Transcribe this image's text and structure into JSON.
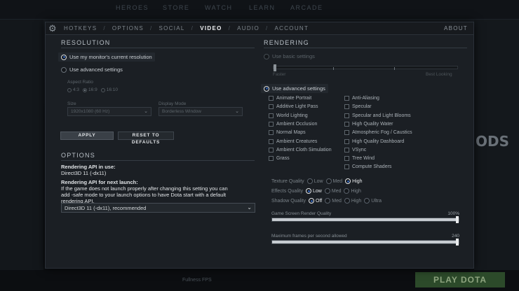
{
  "background": {
    "nav": [
      "HEROES",
      "STORE",
      "WATCH",
      "LEARN",
      "ARCADE"
    ],
    "play_button": "PLAY DOTA",
    "right_text": "ODS",
    "status_text": "Fullness FPS"
  },
  "tabs": {
    "items": [
      "HOTKEYS",
      "OPTIONS",
      "SOCIAL",
      "VIDEO",
      "AUDIO",
      "ACCOUNT"
    ],
    "active": "VIDEO",
    "about": "ABOUT"
  },
  "resolution": {
    "title": "RESOLUTION",
    "use_monitor": "Use my monitor's current resolution",
    "use_advanced": "Use advanced settings",
    "aspect_label": "Aspect Ratio",
    "aspect_options": [
      "4:3",
      "16:9",
      "16:10"
    ],
    "aspect_selected": "16:9",
    "size_label": "Size",
    "size_value": "1920x1080 (60 Hz)",
    "display_label": "Display Mode",
    "display_value": "Borderless Window",
    "apply": "APPLY",
    "reset": "RESET TO DEFAULTS"
  },
  "options": {
    "title": "OPTIONS",
    "api_in_use_label": "Rendering API in use:",
    "api_in_use_value": "Direct3D 11 (-dx11)",
    "api_next_label": "Rendering API for next launch:",
    "api_next_note_1": "If the game does not launch properly after changing this setting you can",
    "api_next_note_2": "add -safe mode to your launch options to have Dota start with a default",
    "api_next_note_3": "rendering API.",
    "api_dropdown": "Direct3D 11 (-dx11), recommended"
  },
  "rendering": {
    "title": "RENDERING",
    "use_basic": "Use basic settings",
    "basic_slider_left": "Faster",
    "basic_slider_right": "Best Looking",
    "use_advanced": "Use advanced settings",
    "checks_left": [
      "Animate Portrait",
      "Additive Light Pass",
      "World Lighting",
      "Ambient Occlusion",
      "Normal Maps",
      "Ambient Creatures",
      "Ambient Cloth Simulation",
      "Grass"
    ],
    "checks_right": [
      "Anti-Aliasing",
      "Specular",
      "Specular and Light Blooms",
      "High Quality Water",
      "Atmospheric Fog / Caustics",
      "High Quality Dashboard",
      "VSync",
      "Tree Wind",
      "Compute Shaders"
    ],
    "texture_quality": {
      "label": "Texture Quality",
      "options": [
        "Low",
        "Med",
        "High"
      ],
      "selected": "High"
    },
    "effects_quality": {
      "label": "Effects Quality",
      "options": [
        "Low",
        "Med",
        "High"
      ],
      "selected": "Low"
    },
    "shadow_quality": {
      "label": "Shadow Quality",
      "options": [
        "Off",
        "Med",
        "High",
        "Ultra"
      ],
      "selected": "Off"
    },
    "render_quality": {
      "label": "Game Screen Render Quality",
      "value_text": "100%",
      "fraction": 1.0
    },
    "max_fps": {
      "label": "Maximum frames per second allowed",
      "value_text": "240",
      "fraction": 1.0
    }
  },
  "colors": {
    "accent": "#2e5ca8",
    "panel": "#1b1f24"
  }
}
